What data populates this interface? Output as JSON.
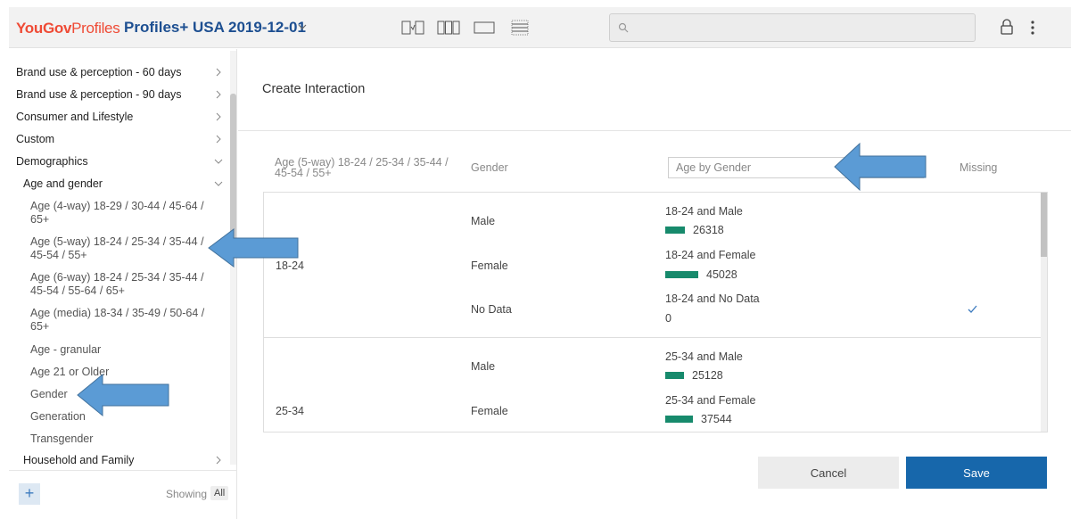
{
  "header": {
    "brand_part1": "YouGov",
    "brand_part2": "Profiles",
    "project_title": "Profiles+ USA 2019-12-01",
    "search_placeholder": ""
  },
  "sidebar": {
    "items": [
      {
        "label": "Brand use & perception - 60 days",
        "level": 0
      },
      {
        "label": "Brand use & perception - 90 days",
        "level": 0
      },
      {
        "label": "Consumer and Lifestyle",
        "level": 0
      },
      {
        "label": "Custom",
        "level": 0
      },
      {
        "label": "Demographics",
        "level": 0
      },
      {
        "label": "Age and gender",
        "level": 1
      },
      {
        "label": "Age (4-way) 18-29 / 30-44 / 45-64 / 65+",
        "level": 2
      },
      {
        "label": "Age (5-way) 18-24 / 25-34 / 35-44 / 45-54 / 55+",
        "level": 2
      },
      {
        "label": "Age (6-way) 18-24 / 25-34 / 35-44 / 45-54 / 55-64 / 65+",
        "level": 2
      },
      {
        "label": "Age (media) 18-34 / 35-49 / 50-64 / 65+",
        "level": 2
      },
      {
        "label": "Age - granular",
        "level": 2
      },
      {
        "label": "Age 21 or Older",
        "level": 2
      },
      {
        "label": "Gender",
        "level": 2
      },
      {
        "label": "Generation",
        "level": 2
      },
      {
        "label": "Transgender",
        "level": 2
      },
      {
        "label": "Household and Family",
        "level": 1
      }
    ],
    "add_label": "+",
    "showing_label": "Showing",
    "showing_value": "All"
  },
  "main": {
    "title": "Create Interaction",
    "columns": {
      "variable1": "Age (5-way) 18-24 / 25-34 / 35-44 / 45-54 / 55+",
      "variable2": "Gender",
      "missing": "Missing"
    },
    "interaction_name": "Age by Gender",
    "rows": [
      {
        "group": "18-24",
        "value": "Male",
        "combo": "18-24 and Male",
        "count": "26318",
        "count_num": 26318,
        "missing": false
      },
      {
        "group": "18-24",
        "value": "Female",
        "combo": "18-24 and Female",
        "count": "45028",
        "count_num": 45028,
        "missing": false
      },
      {
        "group": "18-24",
        "value": "No Data",
        "combo": "18-24 and No Data",
        "count": "0",
        "count_num": 0,
        "missing": true
      },
      {
        "group": "25-34",
        "value": "Male",
        "combo": "25-34 and Male",
        "count": "25128",
        "count_num": 25128,
        "missing": false
      },
      {
        "group": "25-34",
        "value": "Female",
        "combo": "25-34 and Female",
        "count": "37544",
        "count_num": 37544,
        "missing": false
      }
    ],
    "cancel_label": "Cancel",
    "save_label": "Save"
  },
  "colors": {
    "brand": "#ef4b36",
    "project_title": "#1d4f91",
    "bar": "#178a6c",
    "save_button": "#1767ab",
    "annotation_arrow": "#5b9bd5"
  }
}
